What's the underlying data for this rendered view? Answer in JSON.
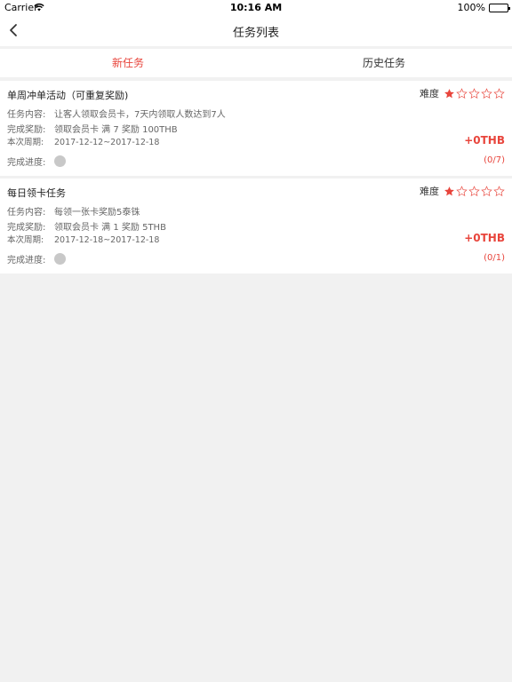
{
  "status_bar": {
    "carrier": "Carrier",
    "time": "10:16 AM",
    "battery": "100%"
  },
  "nav": {
    "title": "任务列表",
    "back_icon": "chevron-left-icon"
  },
  "tabs": [
    {
      "label": "新任务",
      "active": true
    },
    {
      "label": "历史任务",
      "active": false
    }
  ],
  "labels": {
    "difficulty": "难度",
    "content": "任务内容:",
    "reward": "完成奖励:",
    "period": "本次周期:",
    "progress": "完成进度:"
  },
  "tasks": [
    {
      "title": "单周冲单活动（可重复奖励)",
      "difficulty_stars": 1,
      "difficulty_max": 5,
      "content": "让客人领取会员卡，7天内领取人数达到7人",
      "reward": "领取会员卡 满 7 奖励 100THB",
      "period": "2017-12-12~2017-12-18",
      "earned": "+0THB",
      "progress": "(0/7)"
    },
    {
      "title": "每日领卡任务",
      "difficulty_stars": 1,
      "difficulty_max": 5,
      "content": "每领一张卡奖励5泰铢",
      "reward": "领取会员卡 满 1 奖励 5THB",
      "period": "2017-12-18~2017-12-18",
      "earned": "+0THB",
      "progress": "(0/1)"
    }
  ],
  "colors": {
    "accent": "#e8453c",
    "background": "#f1f1f1",
    "progress_dot": "#c8c8c8"
  }
}
